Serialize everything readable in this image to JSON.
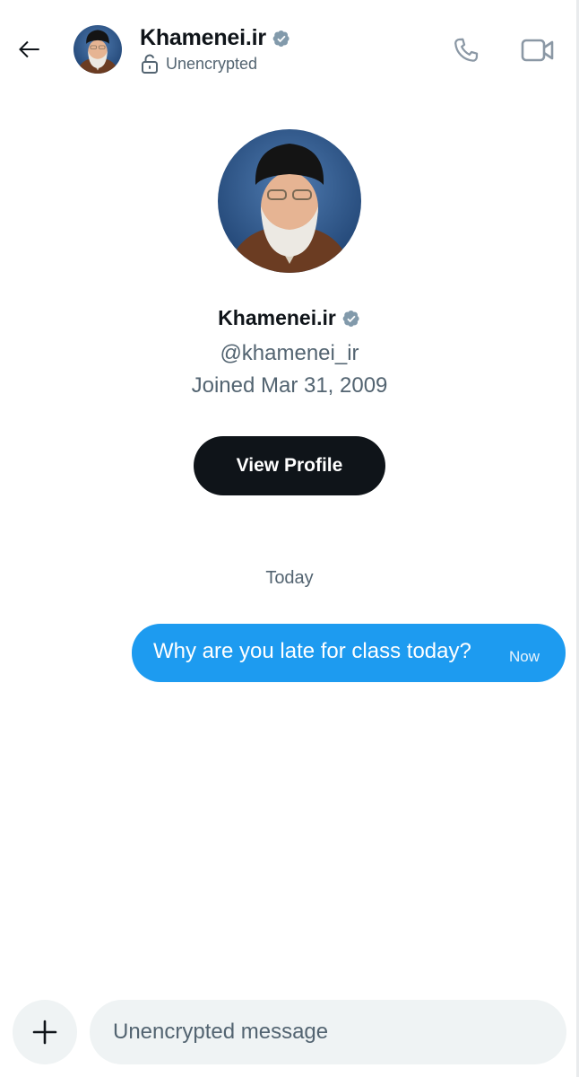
{
  "header": {
    "back_icon": "arrow-left-icon",
    "name": "Khamenei.ir",
    "verified_icon": "verified-badge-icon",
    "encryption_icon": "unlocked-lock-icon",
    "encryption_status": "Unencrypted",
    "call_icon": "phone-icon",
    "video_icon": "video-camera-icon"
  },
  "profile": {
    "name": "Khamenei.ir",
    "handle": "@khamenei_ir",
    "joined": "Joined Mar 31, 2009",
    "view_profile_label": "View Profile"
  },
  "conversation": {
    "date_separator": "Today",
    "messages": [
      {
        "text": "Why are you late for class today?",
        "time": "Now",
        "direction": "outgoing"
      }
    ]
  },
  "composer": {
    "add_icon": "plus-icon",
    "placeholder": "Unencrypted message",
    "value": ""
  },
  "colors": {
    "accent": "#1d9bf0",
    "text_primary": "#0f1419",
    "text_secondary": "#536471",
    "verified_badge": "#829aab",
    "input_bg": "#eff3f4"
  }
}
